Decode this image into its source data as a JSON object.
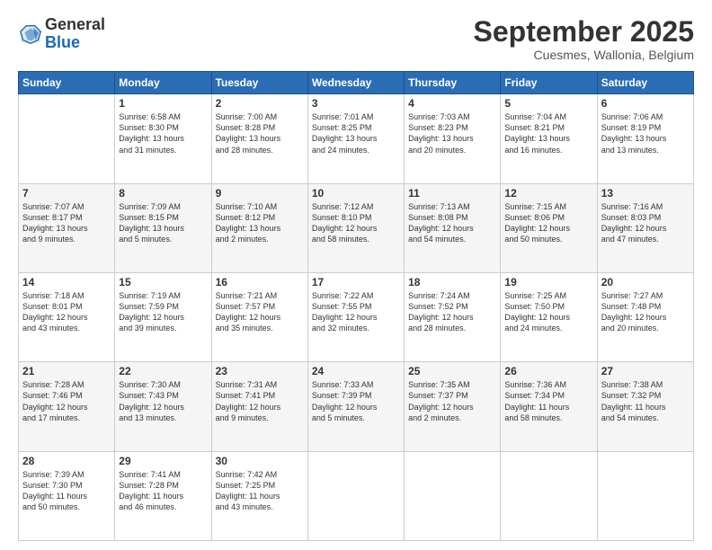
{
  "logo": {
    "general": "General",
    "blue": "Blue"
  },
  "title": "September 2025",
  "subtitle": "Cuesmes, Wallonia, Belgium",
  "weekdays": [
    "Sunday",
    "Monday",
    "Tuesday",
    "Wednesday",
    "Thursday",
    "Friday",
    "Saturday"
  ],
  "weeks": [
    [
      {
        "day": "",
        "info": ""
      },
      {
        "day": "1",
        "info": "Sunrise: 6:58 AM\nSunset: 8:30 PM\nDaylight: 13 hours\nand 31 minutes."
      },
      {
        "day": "2",
        "info": "Sunrise: 7:00 AM\nSunset: 8:28 PM\nDaylight: 13 hours\nand 28 minutes."
      },
      {
        "day": "3",
        "info": "Sunrise: 7:01 AM\nSunset: 8:25 PM\nDaylight: 13 hours\nand 24 minutes."
      },
      {
        "day": "4",
        "info": "Sunrise: 7:03 AM\nSunset: 8:23 PM\nDaylight: 13 hours\nand 20 minutes."
      },
      {
        "day": "5",
        "info": "Sunrise: 7:04 AM\nSunset: 8:21 PM\nDaylight: 13 hours\nand 16 minutes."
      },
      {
        "day": "6",
        "info": "Sunrise: 7:06 AM\nSunset: 8:19 PM\nDaylight: 13 hours\nand 13 minutes."
      }
    ],
    [
      {
        "day": "7",
        "info": "Sunrise: 7:07 AM\nSunset: 8:17 PM\nDaylight: 13 hours\nand 9 minutes."
      },
      {
        "day": "8",
        "info": "Sunrise: 7:09 AM\nSunset: 8:15 PM\nDaylight: 13 hours\nand 5 minutes."
      },
      {
        "day": "9",
        "info": "Sunrise: 7:10 AM\nSunset: 8:12 PM\nDaylight: 13 hours\nand 2 minutes."
      },
      {
        "day": "10",
        "info": "Sunrise: 7:12 AM\nSunset: 8:10 PM\nDaylight: 12 hours\nand 58 minutes."
      },
      {
        "day": "11",
        "info": "Sunrise: 7:13 AM\nSunset: 8:08 PM\nDaylight: 12 hours\nand 54 minutes."
      },
      {
        "day": "12",
        "info": "Sunrise: 7:15 AM\nSunset: 8:06 PM\nDaylight: 12 hours\nand 50 minutes."
      },
      {
        "day": "13",
        "info": "Sunrise: 7:16 AM\nSunset: 8:03 PM\nDaylight: 12 hours\nand 47 minutes."
      }
    ],
    [
      {
        "day": "14",
        "info": "Sunrise: 7:18 AM\nSunset: 8:01 PM\nDaylight: 12 hours\nand 43 minutes."
      },
      {
        "day": "15",
        "info": "Sunrise: 7:19 AM\nSunset: 7:59 PM\nDaylight: 12 hours\nand 39 minutes."
      },
      {
        "day": "16",
        "info": "Sunrise: 7:21 AM\nSunset: 7:57 PM\nDaylight: 12 hours\nand 35 minutes."
      },
      {
        "day": "17",
        "info": "Sunrise: 7:22 AM\nSunset: 7:55 PM\nDaylight: 12 hours\nand 32 minutes."
      },
      {
        "day": "18",
        "info": "Sunrise: 7:24 AM\nSunset: 7:52 PM\nDaylight: 12 hours\nand 28 minutes."
      },
      {
        "day": "19",
        "info": "Sunrise: 7:25 AM\nSunset: 7:50 PM\nDaylight: 12 hours\nand 24 minutes."
      },
      {
        "day": "20",
        "info": "Sunrise: 7:27 AM\nSunset: 7:48 PM\nDaylight: 12 hours\nand 20 minutes."
      }
    ],
    [
      {
        "day": "21",
        "info": "Sunrise: 7:28 AM\nSunset: 7:46 PM\nDaylight: 12 hours\nand 17 minutes."
      },
      {
        "day": "22",
        "info": "Sunrise: 7:30 AM\nSunset: 7:43 PM\nDaylight: 12 hours\nand 13 minutes."
      },
      {
        "day": "23",
        "info": "Sunrise: 7:31 AM\nSunset: 7:41 PM\nDaylight: 12 hours\nand 9 minutes."
      },
      {
        "day": "24",
        "info": "Sunrise: 7:33 AM\nSunset: 7:39 PM\nDaylight: 12 hours\nand 5 minutes."
      },
      {
        "day": "25",
        "info": "Sunrise: 7:35 AM\nSunset: 7:37 PM\nDaylight: 12 hours\nand 2 minutes."
      },
      {
        "day": "26",
        "info": "Sunrise: 7:36 AM\nSunset: 7:34 PM\nDaylight: 11 hours\nand 58 minutes."
      },
      {
        "day": "27",
        "info": "Sunrise: 7:38 AM\nSunset: 7:32 PM\nDaylight: 11 hours\nand 54 minutes."
      }
    ],
    [
      {
        "day": "28",
        "info": "Sunrise: 7:39 AM\nSunset: 7:30 PM\nDaylight: 11 hours\nand 50 minutes."
      },
      {
        "day": "29",
        "info": "Sunrise: 7:41 AM\nSunset: 7:28 PM\nDaylight: 11 hours\nand 46 minutes."
      },
      {
        "day": "30",
        "info": "Sunrise: 7:42 AM\nSunset: 7:25 PM\nDaylight: 11 hours\nand 43 minutes."
      },
      {
        "day": "",
        "info": ""
      },
      {
        "day": "",
        "info": ""
      },
      {
        "day": "",
        "info": ""
      },
      {
        "day": "",
        "info": ""
      }
    ]
  ]
}
